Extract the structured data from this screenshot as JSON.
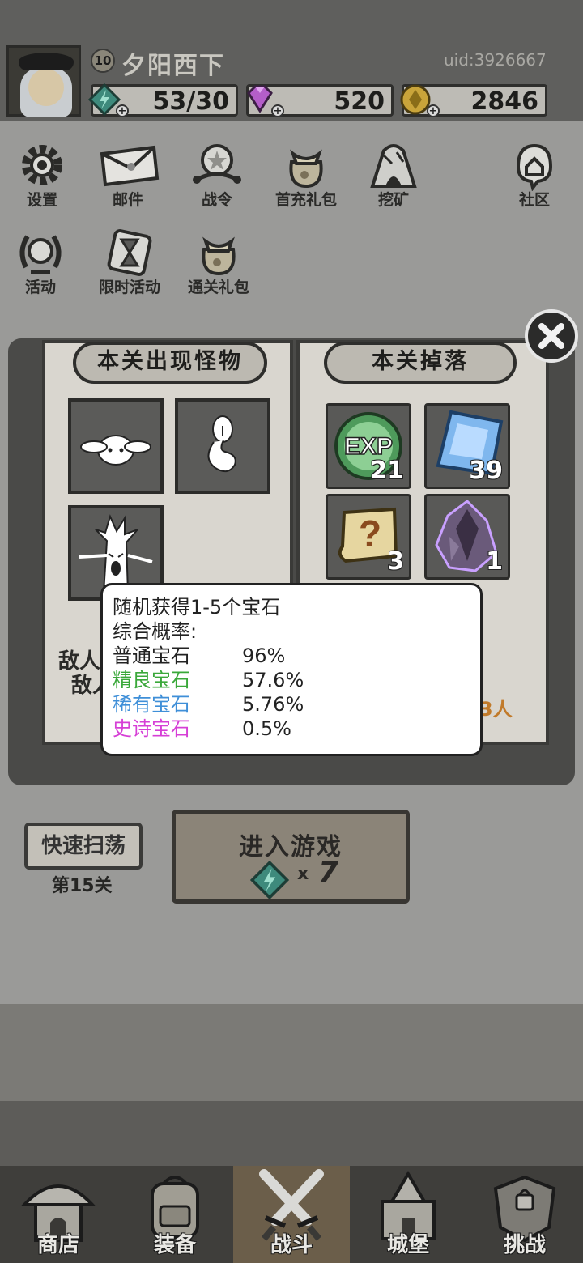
{
  "profile": {
    "level": "10",
    "name": "夕阳西下",
    "uid": "uid:3926667"
  },
  "resources": {
    "stamina": "53/30",
    "diamond": "520",
    "gold": "2846"
  },
  "menu": [
    {
      "label": "设置",
      "icon": "gear-icon"
    },
    {
      "label": "邮件",
      "icon": "envelope-icon"
    },
    {
      "label": "战令",
      "icon": "battle-pass-icon"
    },
    {
      "label": "首充礼包",
      "icon": "gift-bag-icon"
    },
    {
      "label": "挖矿",
      "icon": "mine-icon"
    },
    {
      "label": "社区",
      "icon": "community-icon"
    },
    {
      "label": "活动",
      "icon": "laurel-icon"
    },
    {
      "label": "限时活动",
      "icon": "hourglass-icon"
    },
    {
      "label": "通关礼包",
      "icon": "gift-bag-icon"
    }
  ],
  "book": {
    "left_header": "本关出现怪物",
    "right_header": "本关掉落",
    "partial_left_1": "敌人",
    "partial_left_2": "敌人",
    "partial_right": "3人",
    "drops": [
      {
        "name": "EXP",
        "count": "21"
      },
      {
        "name": "blue-gem",
        "count": "39"
      },
      {
        "name": "scroll",
        "count": "3"
      },
      {
        "name": "crystal",
        "count": "1"
      }
    ]
  },
  "tooltip": {
    "line1": "随机获得1-5个宝石",
    "line2": "综合概率:",
    "rows": [
      {
        "name": "普通宝石",
        "pct": "96%",
        "color": "#222222"
      },
      {
        "name": "精良宝石",
        "pct": "57.6%",
        "color": "#3aa83a"
      },
      {
        "name": "稀有宝石",
        "pct": "5.76%",
        "color": "#3f8fd8"
      },
      {
        "name": "史诗宝石",
        "pct": "0.5%",
        "color": "#d63fd6"
      }
    ]
  },
  "actions": {
    "sweep": "快速扫荡",
    "stage": "第15关",
    "enter": "进入游戏",
    "cost_x": "x",
    "cost": "7"
  },
  "tabs": [
    {
      "label": "商店"
    },
    {
      "label": "装备"
    },
    {
      "label": "战斗"
    },
    {
      "label": "城堡"
    },
    {
      "label": "挑战"
    }
  ]
}
